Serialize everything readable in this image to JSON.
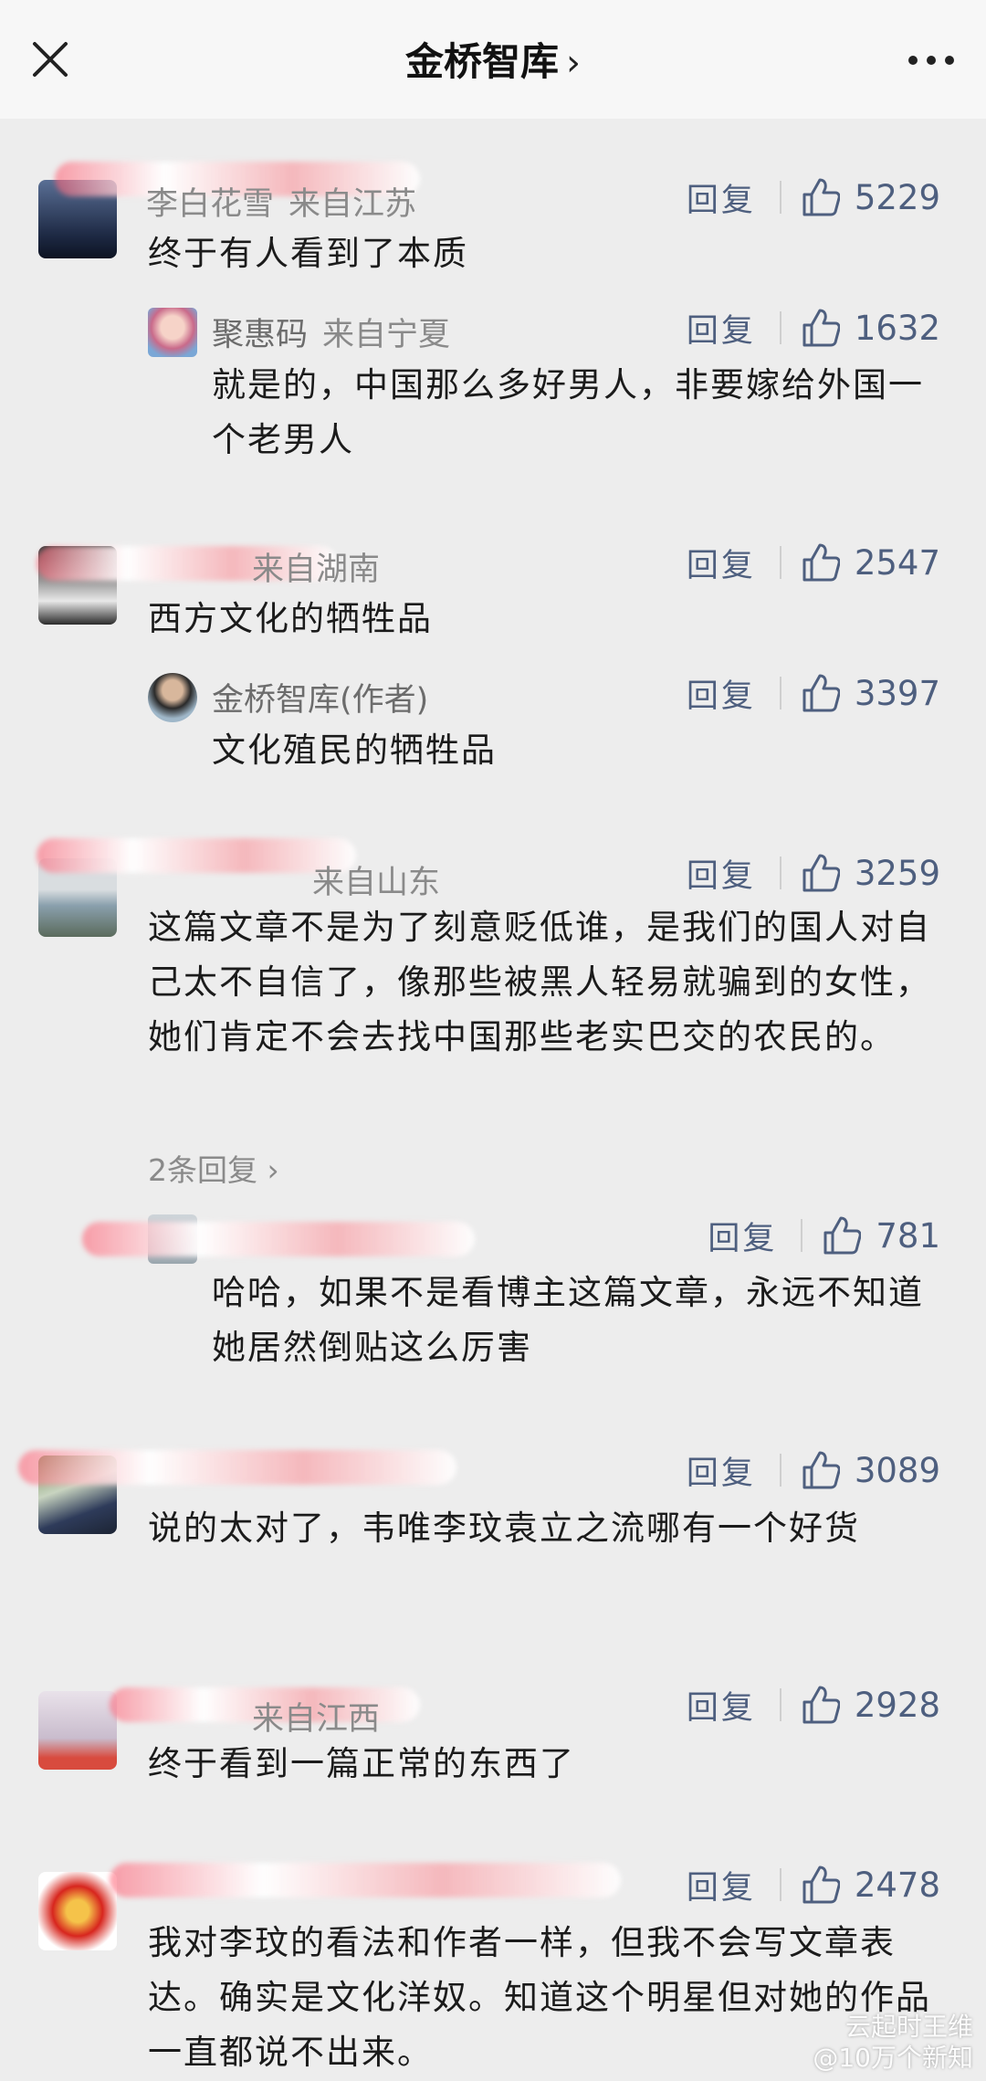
{
  "header": {
    "title": "金桥智库"
  },
  "reply_label": "回复",
  "comments": [
    {
      "name": "李白花雪",
      "location": "来自江苏",
      "likes": "5229",
      "text": "终于有人看到了本质"
    },
    {
      "name": "聚惠码",
      "location": "来自宁夏",
      "likes": "1632",
      "text": "就是的，中国那么多好男人，非要嫁给外国一个老男人"
    },
    {
      "name": "",
      "location": "来自湖南",
      "likes": "2547",
      "text": "西方文化的牺牲品"
    },
    {
      "name": "金桥智库(作者)",
      "location": "",
      "likes": "3397",
      "text": "文化殖民的牺牲品"
    },
    {
      "name": "",
      "location": "来自山东",
      "likes": "3259",
      "text": "这篇文章不是为了刻意贬低谁，是我们的国人对自己太不自信了，像那些被黑人轻易就骗到的女性，她们肯定不会去找中国那些老实巴交的农民的。",
      "more": "2条回复"
    },
    {
      "name": "",
      "location": "",
      "likes": "781",
      "text": "哈哈，如果不是看博主这篇文章，永远不知道她居然倒贴这么厉害"
    },
    {
      "name": "",
      "location": "",
      "likes": "3089",
      "text": "说的太对了，韦唯李玟袁立之流哪有一个好货"
    },
    {
      "name": "",
      "location": "来自江西",
      "likes": "2928",
      "text": "终于看到一篇正常的东西了"
    },
    {
      "name": "",
      "location": "",
      "likes": "2478",
      "text": "我对李玟的看法和作者一样，但我不会写文章表达。确实是文化洋奴。知道这个明星但对她的作品一直都说不出来。"
    }
  ],
  "watermark": {
    "line1": "云起时王维",
    "line2": "@10万个新知"
  }
}
